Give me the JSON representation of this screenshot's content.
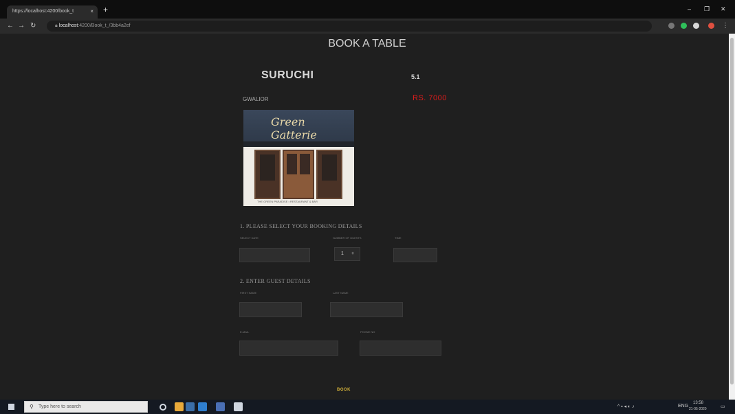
{
  "browser": {
    "tab_title": "https://localhost:4200/book_t",
    "tab_close": "×",
    "new_tab": "+",
    "url_host": "localhost",
    "url_path": ":4200/Book_t_/3bb4a2ef",
    "window_controls": [
      "–",
      "❐",
      "✕"
    ],
    "icons": [
      "back-arrow-icon",
      "forward-arrow-icon",
      "reload-icon",
      "lock-icon"
    ]
  },
  "page": {
    "title": "BOOK A TABLE",
    "restaurant": {
      "name": "SURUCHI",
      "rating": "5.1",
      "location": "GWALIOR",
      "price": "RS. 7000",
      "photo_sign": "Green Gatterie",
      "photo_caption": "THE GREEN PARADISE  •  RESTAURANT & BAR"
    },
    "section1": {
      "title": "1. PLEASE SELECT YOUR BOOKING DETAILS",
      "labels": [
        "SELECT DATE",
        "NUMBER OF GUESTS",
        "TIME"
      ],
      "stepper_value": "1",
      "stepper_plus": "+"
    },
    "section2": {
      "title": "2. ENTER GUEST DETAILS",
      "labels": [
        "FIRST NAME",
        "LAST NAME",
        "E-MAIL",
        "PHONE NO"
      ]
    },
    "book_button": "BOOK"
  },
  "taskbar": {
    "search_placeholder": "Type here to search",
    "clock_time": "13:58",
    "clock_date": "21-05-2020",
    "lang": "ENG"
  },
  "colors": {
    "page_bg": "#1f1f1f",
    "price": "#e11c1c",
    "book_button": "#d4b23a"
  }
}
